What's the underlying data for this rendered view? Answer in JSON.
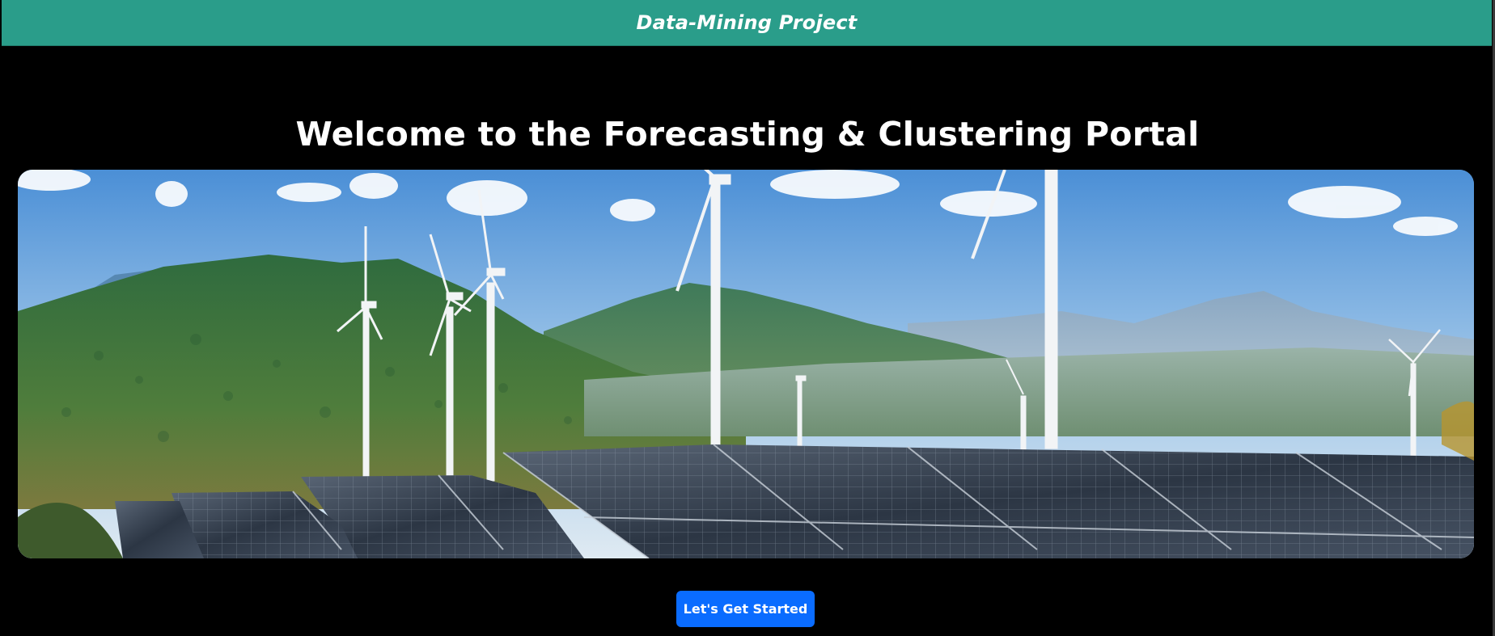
{
  "header": {
    "brand": "Data-Mining Project",
    "background_color": "#2a9d8a"
  },
  "hero": {
    "title": "Welcome to the Forecasting & Clustering Portal",
    "image_subject": "wind-turbines-and-solar-panels-landscape"
  },
  "cta": {
    "label": "Let's Get Started",
    "color": "#0a6cff"
  }
}
